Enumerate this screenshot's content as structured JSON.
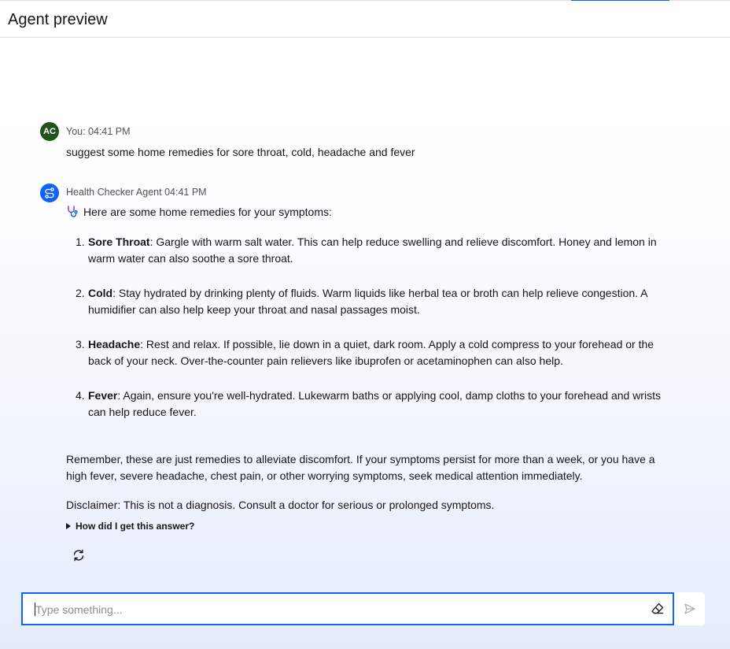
{
  "header": {
    "title": "Agent preview"
  },
  "user_message": {
    "avatar_initials": "AC",
    "meta": "You: 04:41 PM",
    "text": "suggest some home remedies for sore throat, cold, headache and fever"
  },
  "agent_message": {
    "meta": "Health Checker Agent 04:41 PM",
    "intro_icon": "stethoscope-icon",
    "intro": "Here are some home remedies for your symptoms:",
    "remedies": [
      {
        "num": "1.",
        "title": "Sore Throat",
        "text": ": Gargle with warm salt water. This can help reduce swelling and relieve discomfort. Honey and lemon in warm water can also soothe a sore throat."
      },
      {
        "num": "2.",
        "title": "Cold",
        "text": ": Stay hydrated by drinking plenty of fluids. Warm liquids like herbal tea or broth can help relieve congestion. A humidifier can also help keep your throat and nasal passages moist."
      },
      {
        "num": "3.",
        "title": "Headache",
        "text": ": Rest and relax. If possible, lie down in a quiet, dark room. Apply a cold compress to your forehead or the back of your neck. Over-the-counter pain relievers like ibuprofen or acetaminophen can also help."
      },
      {
        "num": "4.",
        "title": "Fever",
        "text": ": Again, ensure you're well-hydrated. Lukewarm baths or applying cool, damp cloths to your forehead and wrists can help reduce fever."
      }
    ],
    "reminder": "Remember, these are just remedies to alleviate discomfort. If your symptoms persist for more than a week, or you have a high fever, severe headache, chest pain, or other worrying symptoms, seek medical attention immediately.",
    "disclaimer": "Disclaimer: This is not a diagnosis. Consult a doctor for serious or prolonged symptoms.",
    "details_label": "How did I get this answer?"
  },
  "composer": {
    "placeholder": "Type something...",
    "value": ""
  },
  "colors": {
    "accent": "#0f62fe",
    "user_avatar": "#24521f"
  }
}
